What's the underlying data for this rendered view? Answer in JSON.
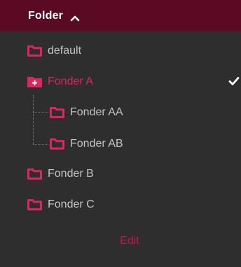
{
  "header": {
    "title": "Folder",
    "toggle_icon": "chevron-up-icon"
  },
  "folders": [
    {
      "label": "default",
      "icon": "folder-icon"
    },
    {
      "label": "Fonder A",
      "icon": "folder-add-icon",
      "selected": true
    },
    {
      "label": "Fonder AA",
      "icon": "folder-icon"
    },
    {
      "label": "Fonder AB",
      "icon": "folder-icon"
    },
    {
      "label": "Fonder B",
      "icon": "folder-icon"
    },
    {
      "label": "Fonder C",
      "icon": "folder-icon"
    }
  ],
  "footer": {
    "edit_label": "Edit"
  },
  "colors": {
    "header_bg": "#5b0a24",
    "panel_bg": "#2e2e2e",
    "accent": "#e0245e",
    "text": "#c4c4c4"
  }
}
